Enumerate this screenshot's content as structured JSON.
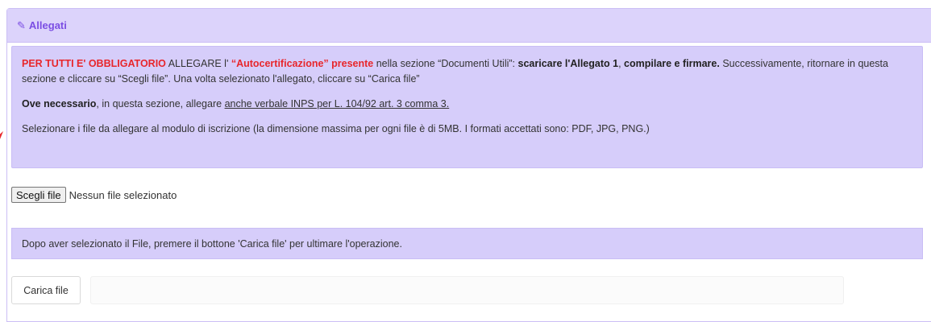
{
  "header": {
    "icon": "paperclip-icon",
    "title": "Allegati"
  },
  "info": {
    "p1_red": "PER TUTTI E' OBBLIGATORIO",
    "p1_a": " ALLEGARE l' ",
    "p1_red2": "“Autocertificazione” presente",
    "p1_b": " nella sezione “Documenti Utili”: ",
    "p1_bold1": "scaricare l'Allegato 1",
    "p1_c": ", ",
    "p1_bold2": "compilare e firmare.",
    "p1_d": " Successivamente, ritornare in questa sezione e cliccare su  “Scegli file”. Una volta selezionato l'allegato, cliccare su “Carica file”",
    "p2_bold": "Ove necessario",
    "p2_a": ", in questa sezione, allegare ",
    "p2_link": "anche verbale INPS per L. 104/92 art. 3 comma 3.",
    "p3": "Selezionare i file da allegare al modulo di iscrizione (la dimensione massima per ogni file è di 5MB. I formati accettati sono: PDF, JPG, PNG.)"
  },
  "file_input": {
    "button_label": "Scegli file",
    "status": "Nessun file selezionato"
  },
  "notice": "Dopo aver selezionato il File, premere il bottone 'Carica file' per ultimare l'operazione.",
  "upload": {
    "button_label": "Carica file",
    "progress": 0
  },
  "colors": {
    "accent": "#7b4ee3",
    "panel_bg": "#d6cdfa",
    "warning": "#e8262b"
  }
}
